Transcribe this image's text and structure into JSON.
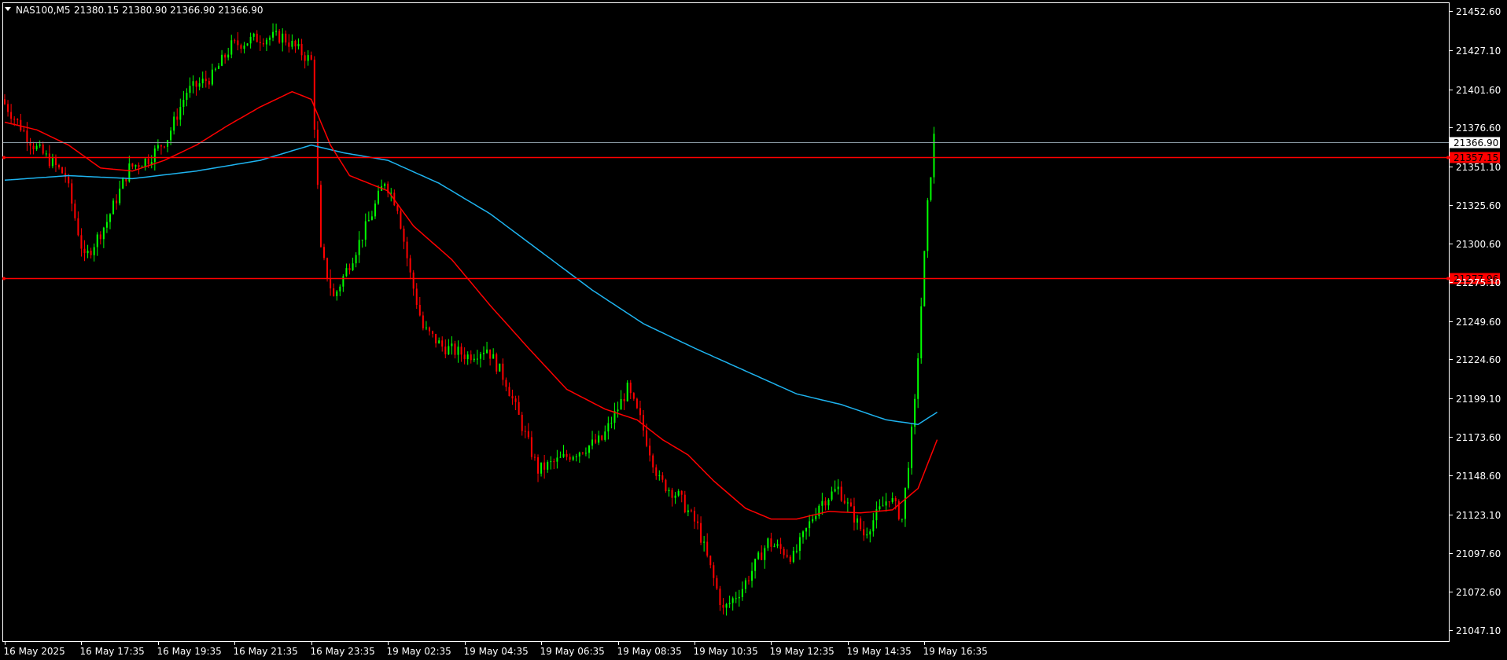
{
  "header": {
    "symbol_timeframe": "NAS100,M5",
    "ohlc": "21380.15 21380.90 21366.90 21366.90"
  },
  "colors": {
    "background": "#000000",
    "frame": "#ffffff",
    "text": "#ffffff",
    "bull_candle": "#00ff00",
    "bear_candle": "#ff0000",
    "ma_fast": "#ff0000",
    "ma_slow": "#1eb4f0",
    "bid_line": "#8a9aa3",
    "level_line": "#ff0000",
    "price_tag_text": "#000000"
  },
  "chart_data": {
    "type": "candlestick",
    "y_axis": {
      "min": 21040,
      "max": 21458,
      "tick_labels": [
        "21452.60",
        "21427.10",
        "21401.60",
        "21376.60",
        "21351.10",
        "21325.60",
        "21300.60",
        "21275.10",
        "21249.60",
        "21224.60",
        "21199.10",
        "21173.60",
        "21148.60",
        "21123.10",
        "21097.60",
        "21072.60",
        "21047.10"
      ],
      "tick_values": [
        21452.6,
        21427.1,
        21401.6,
        21376.6,
        21351.1,
        21325.6,
        21300.6,
        21275.1,
        21249.6,
        21224.6,
        21199.1,
        21173.6,
        21148.6,
        21123.1,
        21097.6,
        21072.6,
        21047.1
      ]
    },
    "x_axis": {
      "labels": [
        "16 May 2025",
        "16 May 17:35",
        "16 May 19:35",
        "16 May 21:35",
        "16 May 23:35",
        "19 May 02:35",
        "19 May 04:35",
        "19 May 06:35",
        "19 May 08:35",
        "19 May 10:35",
        "19 May 12:35",
        "19 May 14:35",
        "19 May 16:35"
      ],
      "positions": [
        0,
        24,
        48,
        72,
        96,
        120,
        144,
        168,
        192,
        216,
        240,
        264,
        288
      ],
      "total_bars": 292
    },
    "price_levels": [
      {
        "label": "21366.90",
        "value": 21366.9,
        "kind": "bid"
      },
      {
        "label": "21357.15",
        "value": 21357.15,
        "kind": "level"
      },
      {
        "label": "21277.96",
        "value": 21277.96,
        "kind": "level"
      }
    ],
    "price_path": [
      [
        0,
        21395
      ],
      [
        10,
        21365
      ],
      [
        20,
        21345
      ],
      [
        26,
        21290
      ],
      [
        33,
        21315
      ],
      [
        40,
        21350
      ],
      [
        46,
        21356
      ],
      [
        52,
        21370
      ],
      [
        58,
        21400
      ],
      [
        66,
        21410
      ],
      [
        72,
        21430
      ],
      [
        80,
        21435
      ],
      [
        88,
        21436
      ],
      [
        97,
        21420
      ],
      [
        100,
        21295
      ],
      [
        104,
        21265
      ],
      [
        110,
        21292
      ],
      [
        116,
        21320
      ],
      [
        120,
        21342
      ],
      [
        124,
        21325
      ],
      [
        128,
        21280
      ],
      [
        132,
        21245
      ],
      [
        138,
        21233
      ],
      [
        146,
        21227
      ],
      [
        152,
        21232
      ],
      [
        158,
        21210
      ],
      [
        168,
        21152
      ],
      [
        178,
        21162
      ],
      [
        188,
        21172
      ],
      [
        196,
        21205
      ],
      [
        200,
        21185
      ],
      [
        206,
        21145
      ],
      [
        212,
        21135
      ],
      [
        218,
        21115
      ],
      [
        226,
        21060
      ],
      [
        232,
        21075
      ],
      [
        240,
        21105
      ],
      [
        248,
        21095
      ],
      [
        256,
        21130
      ],
      [
        262,
        21140
      ],
      [
        270,
        21110
      ],
      [
        278,
        21135
      ],
      [
        282,
        21120
      ],
      [
        286,
        21195
      ],
      [
        290,
        21325
      ],
      [
        292,
        21370
      ]
    ],
    "ma_fast_path": [
      [
        0,
        21380
      ],
      [
        10,
        21375
      ],
      [
        20,
        21365
      ],
      [
        30,
        21350
      ],
      [
        40,
        21348
      ],
      [
        50,
        21355
      ],
      [
        60,
        21365
      ],
      [
        70,
        21378
      ],
      [
        80,
        21390
      ],
      [
        90,
        21400
      ],
      [
        96,
        21395
      ],
      [
        102,
        21365
      ],
      [
        108,
        21345
      ],
      [
        114,
        21340
      ],
      [
        120,
        21335
      ],
      [
        128,
        21312
      ],
      [
        140,
        21290
      ],
      [
        152,
        21260
      ],
      [
        164,
        21232
      ],
      [
        176,
        21205
      ],
      [
        188,
        21192
      ],
      [
        198,
        21185
      ],
      [
        206,
        21172
      ],
      [
        214,
        21162
      ],
      [
        222,
        21145
      ],
      [
        232,
        21127
      ],
      [
        240,
        21120
      ],
      [
        248,
        21120
      ],
      [
        258,
        21125
      ],
      [
        268,
        21124
      ],
      [
        278,
        21126
      ],
      [
        286,
        21140
      ],
      [
        292,
        21172
      ]
    ],
    "ma_slow_path": [
      [
        0,
        21342
      ],
      [
        20,
        21345
      ],
      [
        40,
        21343
      ],
      [
        60,
        21348
      ],
      [
        80,
        21355
      ],
      [
        96,
        21365
      ],
      [
        106,
        21360
      ],
      [
        120,
        21355
      ],
      [
        136,
        21340
      ],
      [
        152,
        21320
      ],
      [
        168,
        21295
      ],
      [
        184,
        21270
      ],
      [
        200,
        21248
      ],
      [
        216,
        21232
      ],
      [
        232,
        21217
      ],
      [
        248,
        21202
      ],
      [
        262,
        21195
      ],
      [
        276,
        21185
      ],
      [
        286,
        21182
      ],
      [
        292,
        21190
      ]
    ]
  }
}
